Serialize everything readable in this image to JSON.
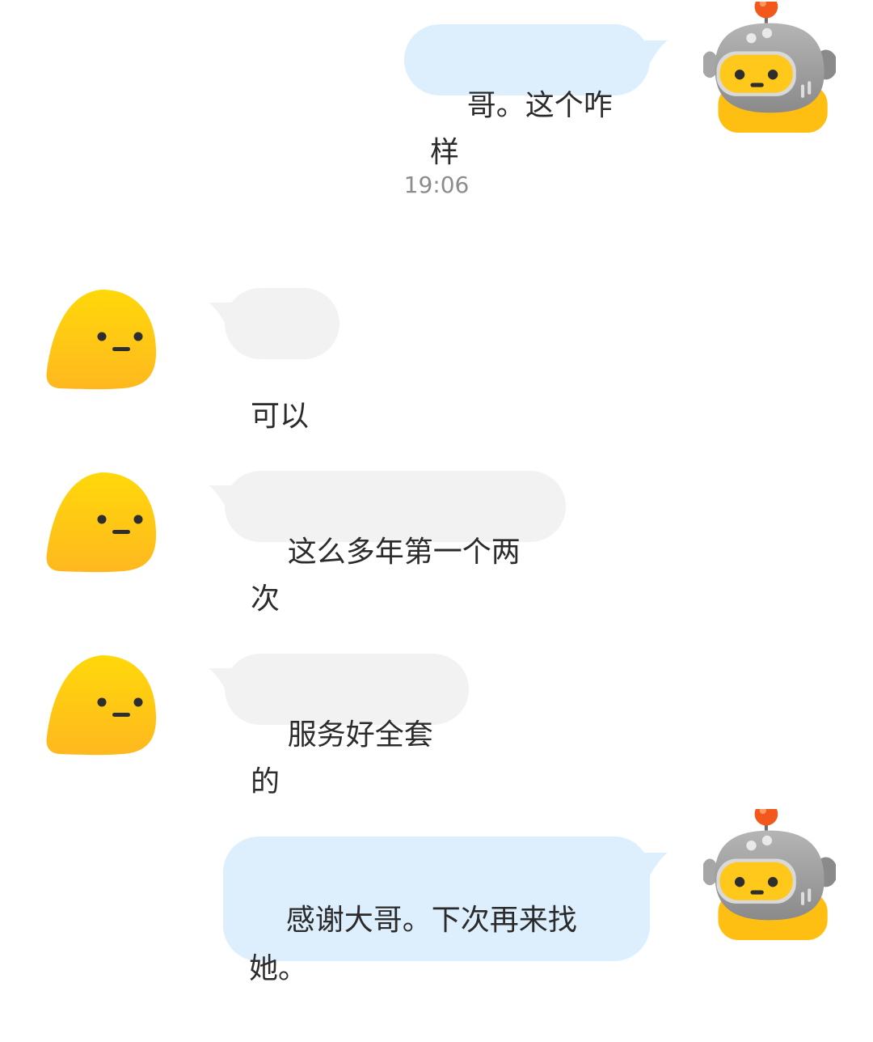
{
  "chat": {
    "messages": [
      {
        "from": "me",
        "text": "哥。这个咋样"
      },
      {
        "from": "other",
        "text": "可以"
      },
      {
        "from": "other",
        "text": "这么多年第一个两次"
      },
      {
        "from": "other",
        "text": "服务好全套的"
      },
      {
        "from": "me",
        "text": "感谢大哥。下次再来找\n她。"
      }
    ],
    "timestamp": "19:06"
  },
  "colors": {
    "incoming_bubble": "#f2f2f2",
    "outgoing_bubble": "#ddeefd",
    "blob_avatar_yellow": "#ffcc1a",
    "robot_avatar_gray": "#9a9a9a",
    "robot_antenna_red": "#f2571c"
  },
  "icons": {
    "incoming_avatar": "yellow-blob-face-icon",
    "outgoing_avatar": "robot-head-icon"
  }
}
